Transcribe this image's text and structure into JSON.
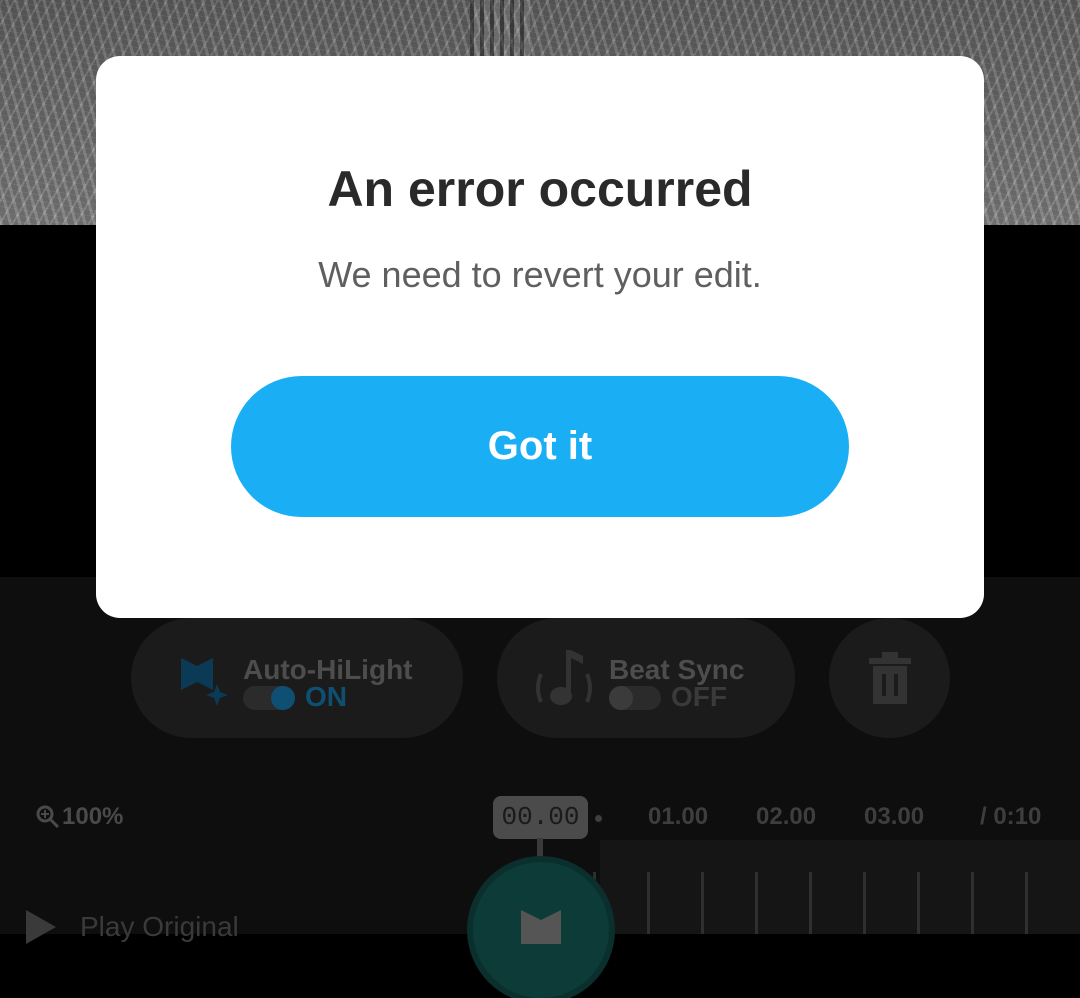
{
  "dialog": {
    "title": "An error occurred",
    "message": "We need to revert your edit.",
    "button_label": "Got it"
  },
  "controls": {
    "auto_hilight": {
      "label": "Auto-HiLight",
      "state": "ON",
      "enabled": true
    },
    "beat_sync": {
      "label": "Beat Sync",
      "state": "OFF",
      "enabled": false
    },
    "delete_icon": "trash-icon"
  },
  "timeline": {
    "zoom": "100%",
    "current_time": "00.00",
    "ticks": [
      "01.00",
      "02.00",
      "03.00"
    ],
    "duration": "/ 0:10"
  },
  "play_original": {
    "label": "Play Original"
  },
  "colors": {
    "accent": "#1aaff5",
    "toggle_on": "#0f5f8a",
    "dialog_bg": "#ffffff"
  }
}
